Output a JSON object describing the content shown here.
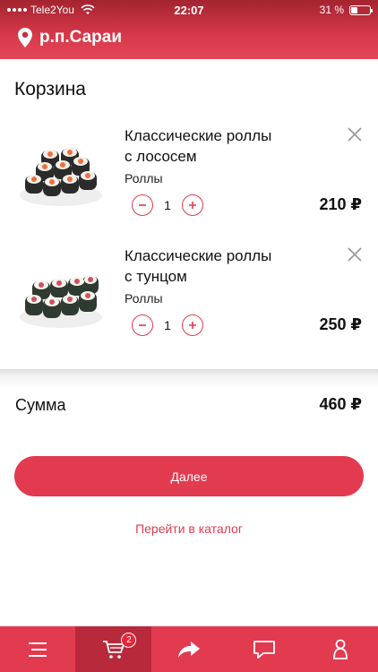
{
  "status_bar": {
    "carrier": "Tele2You",
    "time": "22:07",
    "battery_percent": "31 %",
    "battery_level": 0.31
  },
  "header": {
    "location": "р.п.Сараи"
  },
  "cart": {
    "title": "Корзина",
    "items": [
      {
        "name_line1": "Классические роллы",
        "name_line2": "с лососем",
        "category": "Роллы",
        "quantity": "1",
        "price": "210 ₽",
        "image_icon": "salmon-rolls-image"
      },
      {
        "name_line1": "Классические роллы",
        "name_line2": "с тунцом",
        "category": "Роллы",
        "quantity": "1",
        "price": "250 ₽",
        "image_icon": "tuna-rolls-image"
      }
    ],
    "total_label": "Сумма",
    "total_value": "460 ₽",
    "next_label": "Далее",
    "catalog_link": "Перейти в каталог"
  },
  "tabbar": {
    "cart_badge": "2",
    "tabs": [
      "menu-icon",
      "cart-icon",
      "share-icon",
      "chat-icon",
      "profile-icon"
    ]
  },
  "colors": {
    "accent": "#e23a4f",
    "tab_active": "#b82a3b"
  }
}
